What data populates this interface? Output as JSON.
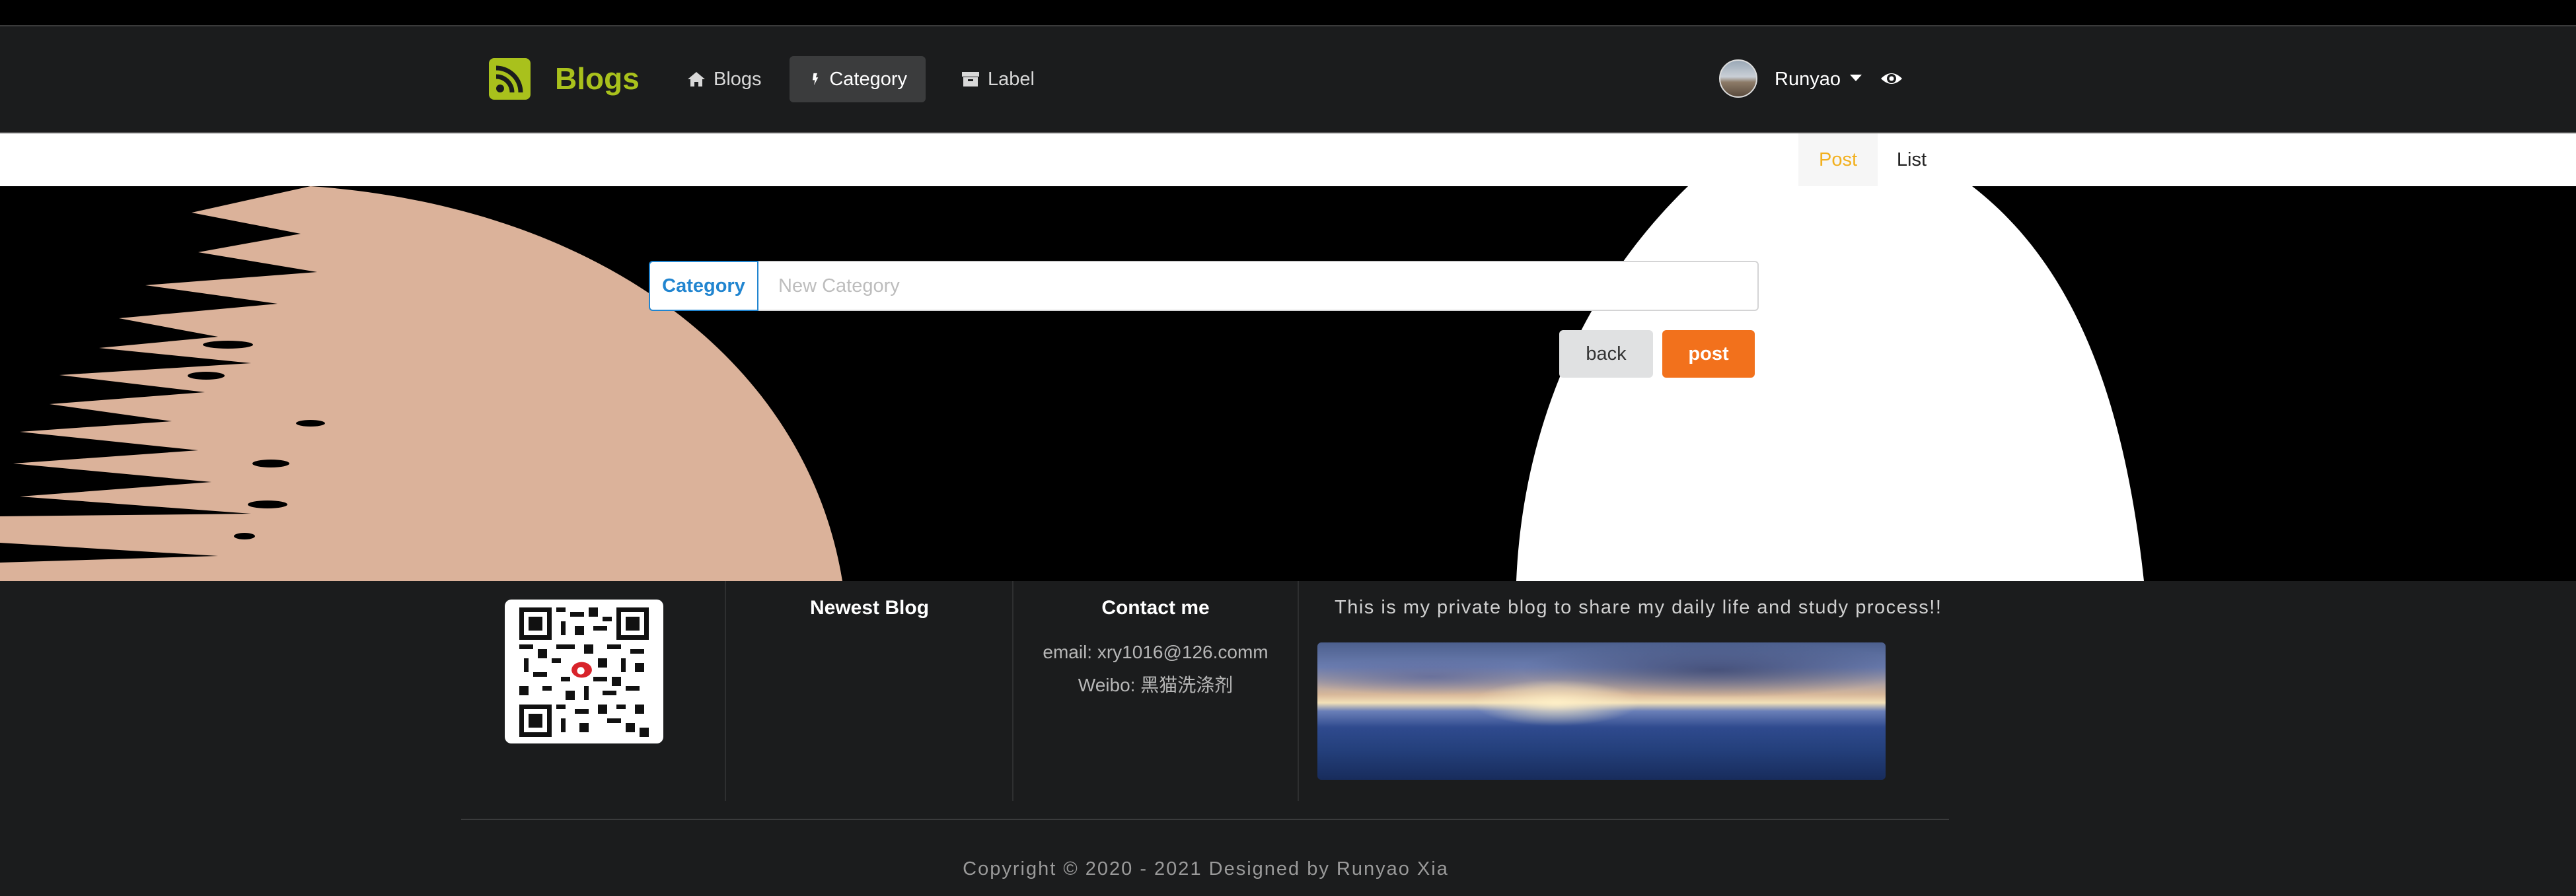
{
  "header": {
    "brand": "Blogs",
    "nav": [
      {
        "label": "Blogs",
        "icon": "home-icon"
      },
      {
        "label": "Category",
        "icon": "bolt-icon",
        "active": true
      },
      {
        "label": "Label",
        "icon": "archive-icon"
      }
    ],
    "user": {
      "name": "Runyao"
    }
  },
  "tabs": [
    {
      "label": "Post",
      "active": true
    },
    {
      "label": "List"
    }
  ],
  "form": {
    "label": "Category",
    "input_value": "",
    "input_placeholder": "New Category",
    "back_label": "back",
    "post_label": "post"
  },
  "footer": {
    "newest_title": "Newest Blog",
    "contact_title": "Contact me",
    "email": "email: xry1016@126.comm",
    "weibo": "Weibo: 黑猫洗涤剂",
    "intro": "This is my private blog to share my daily life and study process!!",
    "copyright": "Copyright © 2020 - 2021 Designed by Runyao Xia"
  },
  "colors": {
    "brand": "#a9c11c",
    "primary": "#2185d0",
    "orange": "#f2711c",
    "active_tab": "#f2b01e",
    "header_bg": "#1b1c1d"
  }
}
